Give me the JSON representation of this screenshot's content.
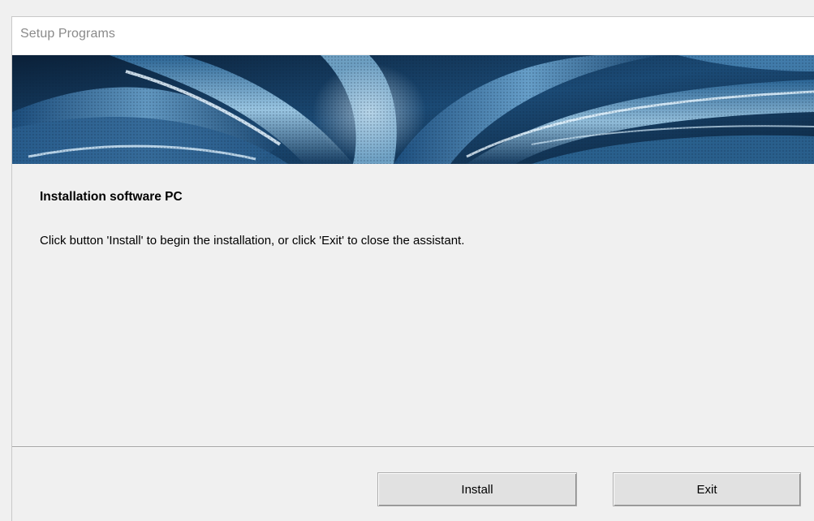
{
  "window": {
    "title": "Setup Programs"
  },
  "banner": {
    "image": "abstract-blue-swirl-banner",
    "colors": [
      "#0d2a4a",
      "#2f6d9e",
      "#bfe1f5"
    ]
  },
  "content": {
    "heading": "Installation software PC",
    "description": "Click button 'Install' to begin the installation, or click 'Exit' to close the assistant."
  },
  "buttons": {
    "install_label": "Install",
    "exit_label": "Exit"
  }
}
